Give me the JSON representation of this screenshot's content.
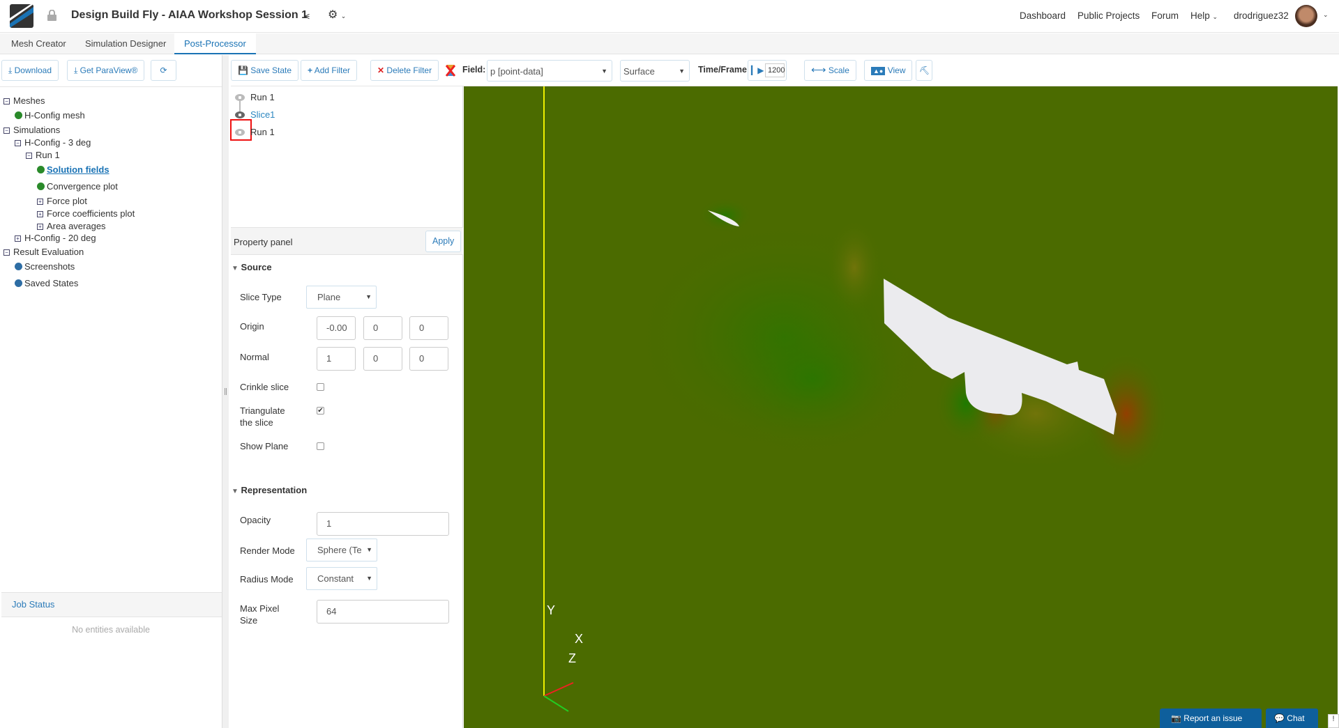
{
  "header": {
    "title": "Design Build Fly - AIAA Workshop Session 1",
    "nav": [
      "Dashboard",
      "Public Projects",
      "Forum",
      "Help"
    ],
    "username": "drodriguez32"
  },
  "tabs": [
    "Mesh Creator",
    "Simulation Designer",
    "Post-Processor"
  ],
  "left_toolbar": {
    "download": "Download",
    "paraview": "Get ParaView®"
  },
  "tree": {
    "meshes": "Meshes",
    "mesh1": "H-Config mesh",
    "simulations": "Simulations",
    "sim1": "H-Config - 3 deg",
    "run": "Run 1",
    "solution": "Solution fields",
    "convergence": "Convergence plot",
    "force": "Force plot",
    "forcecoef": "Force coefficients plot",
    "area": "Area averages",
    "sim2": "H-Config - 20 deg",
    "result": "Result Evaluation",
    "screenshots": "Screenshots",
    "saved": "Saved States"
  },
  "job_status": {
    "title": "Job Status",
    "empty": "No entities available"
  },
  "toolbar": {
    "save_state": "Save State",
    "add_filter": "Add Filter",
    "delete_filter": "Delete Filter",
    "field_label": "Field:",
    "field_value": "p [point-data]",
    "repr_value": "Surface",
    "time_label": "Time/Frame:",
    "time_value": "1200",
    "scale": "Scale",
    "view": "View"
  },
  "pipeline": [
    "Run 1",
    "Slice1",
    "Run 1"
  ],
  "property_panel": {
    "title": "Property panel",
    "apply": "Apply",
    "source": {
      "title": "Source",
      "slice_type_label": "Slice Type",
      "slice_type": "Plane",
      "origin_label": "Origin",
      "origin": [
        "-0.00",
        "0",
        "0"
      ],
      "normal_label": "Normal",
      "normal": [
        "1",
        "0",
        "0"
      ],
      "crinkle_label": "Crinkle slice",
      "crinkle": false,
      "triangulate_label": "Triangulate the slice",
      "triangulate": true,
      "show_plane_label": "Show Plane",
      "show_plane": false
    },
    "representation": {
      "title": "Representation",
      "opacity_label": "Opacity",
      "opacity": "1",
      "render_mode_label": "Render Mode",
      "render_mode": "Sphere (Te",
      "radius_mode_label": "Radius Mode",
      "radius_mode": "Constant",
      "max_pixel_label": "Max Pixel Size",
      "max_pixel": "64"
    }
  },
  "viewport": {
    "axes": [
      "Y",
      "X",
      "Z"
    ],
    "background": "#4b6b00"
  },
  "footer": {
    "report": "Report an issue",
    "chat": "Chat"
  }
}
